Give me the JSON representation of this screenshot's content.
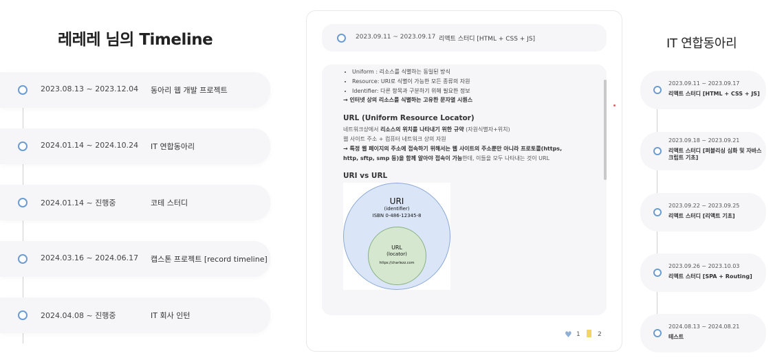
{
  "left": {
    "title": "레레레 님의 Timeline",
    "items": [
      {
        "date": "2023.08.13 ~ 2023.12.04",
        "name": "동아리 웹 개발 프로젝트"
      },
      {
        "date": "2024.01.14 ~ 2024.10.24",
        "name": "IT 연합동아리"
      },
      {
        "date": "2024.01.14 ~ 진행중",
        "name": "코테 스터디"
      },
      {
        "date": "2024.03.16 ~ 2024.06.17",
        "name": "캡스톤 프로젝트 [record timeline]"
      },
      {
        "date": "2024.04.08 ~ 진행중",
        "name": "IT 회사 인턴"
      }
    ]
  },
  "card": {
    "header": {
      "date": "2023.09.11 ~ 2023.09.17",
      "name": "리액트 스터디 [HTML + CSS + JS]"
    },
    "bullets": [
      "Uniform : 리소스를 식별하는 동일된 방식",
      "Resource: URI로 식별이 가능한 모든 종류의 자원",
      "Identifier: 다른 항목과 구분하기 위해 필요한 정보"
    ],
    "uri_summary": "→ 인터넷 상의 리소스를 식별하는 고유한 문자열 시퀀스",
    "url_heading": "URL (Uniform Resource Locator)",
    "url_def_prefix": "네트워크상에서 ",
    "url_def_bold": "리소스의 위치를 나타내기 위한 규약",
    "url_def_suffix": " (자원식별자+위치)",
    "url_site": "웹 사이트 주소 + 컴퓨터 네트워크 상의 자원",
    "url_note_bold_1": "→ 특정 웹 페이지의 주소에 접속하기 위해서는 웹 사이트의 주소뿐만 아니라 프로토콜(https,",
    "url_note_bold_2": "http, sftp, smp 등)을 함께 알아야 접속이 가능",
    "url_note_suffix": "한데, 이들을 모두 나타내는 것이 URL",
    "vs_heading": "URI vs URL",
    "diagram": {
      "uri_label": "URI",
      "uri_sub": "(identifier)",
      "uri_example": "ISBN 0-486-12345-8",
      "url_label": "URL",
      "url_sub": "(locator)",
      "url_example": "https://charlezz.com"
    },
    "likes": "1",
    "saves": "2"
  },
  "right": {
    "title": "IT 연합동아리",
    "items": [
      {
        "date": "2023.09.11 ~ 2023.09.17",
        "name": "리액트 스터디 [HTML + CSS + JS]"
      },
      {
        "date": "2023.09.18 ~ 2023.09.21",
        "name": "리액트 스터디 [퍼블리싱 심화 및 자바스크립트 기초]"
      },
      {
        "date": "2023.09.22 ~ 2023.09.25",
        "name": "리액트 스터디 [리액트 기초]"
      },
      {
        "date": "2023.09.26 ~ 2023.10.03",
        "name": "리액트 스터디 [SPA + Routing]"
      },
      {
        "date": "2024.08.13 ~ 2024.08.21",
        "name": "테스트"
      }
    ]
  },
  "colors": {
    "accent": "#6b9bd1",
    "item_bg": "#f6f5f7",
    "uri_fill": "#dae6f8",
    "url_fill": "#d5e8cf",
    "bookmark": "#f0d56a"
  }
}
